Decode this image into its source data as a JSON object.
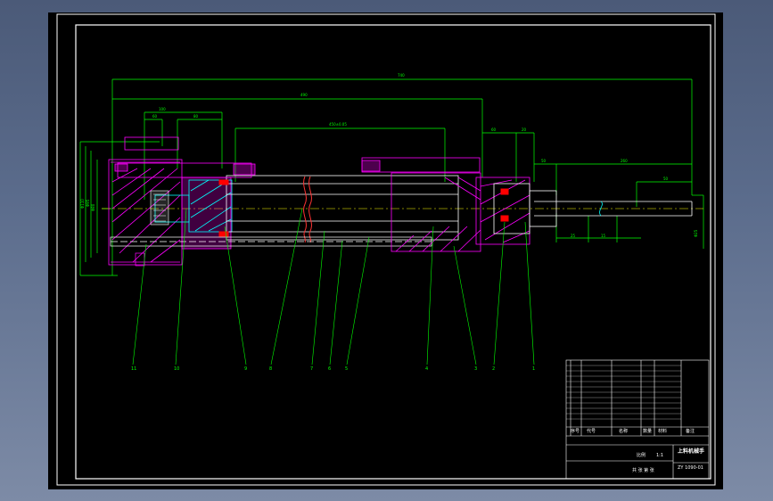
{
  "drawing": {
    "title": "上料机械手",
    "drawing_number": "ZY 1090-01",
    "layer_color_outline": "#ffffff",
    "layer_color_dims": "#00ff00",
    "layer_color_section": "#ff00ff",
    "layer_color_hatch": "#00ffff",
    "layer_color_seal": "#ff0000",
    "layer_color_center": "#ffff00"
  },
  "callouts": [
    "11",
    "10",
    "9",
    "8",
    "7",
    "6",
    "5",
    "4",
    "3",
    "2",
    "1"
  ],
  "title_block": {
    "header": [
      "序号",
      "代号",
      "名称",
      "数量",
      "材料",
      "备注"
    ],
    "scale_label": "比例",
    "scale_value": "1:1",
    "sheet_label": "共 张 第 张"
  }
}
